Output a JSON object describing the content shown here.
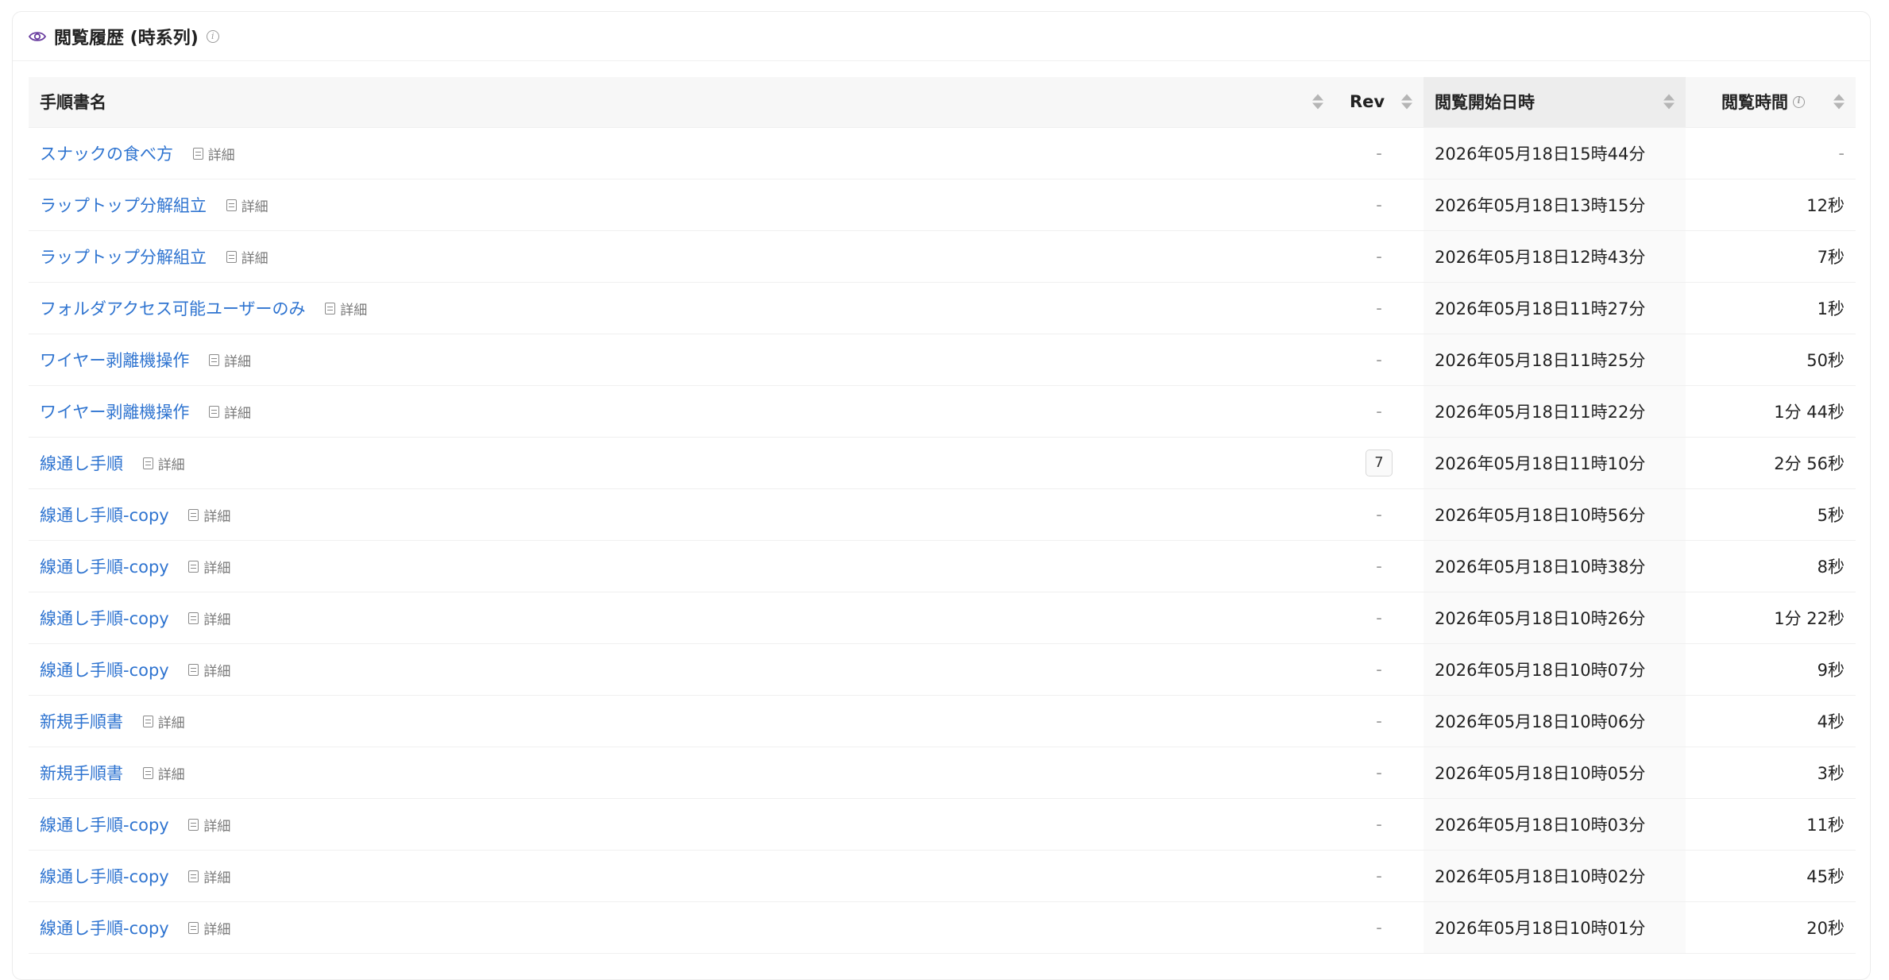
{
  "panel": {
    "title": "閲覧履歴 (時系列)"
  },
  "table": {
    "headers": {
      "name": "手順書名",
      "rev": "Rev",
      "start": "閲覧開始日時",
      "duration": "閲覧時間"
    },
    "detail_label": "詳細",
    "rows": [
      {
        "name": "スナックの食べ方",
        "rev": "-",
        "start": "2026年05月18日15時44分",
        "duration": "-"
      },
      {
        "name": "ラップトップ分解組立",
        "rev": "-",
        "start": "2026年05月18日13時15分",
        "duration": "12秒"
      },
      {
        "name": "ラップトップ分解組立",
        "rev": "-",
        "start": "2026年05月18日12時43分",
        "duration": "7秒"
      },
      {
        "name": "フォルダアクセス可能ユーザーのみ",
        "rev": "-",
        "start": "2026年05月18日11時27分",
        "duration": "1秒"
      },
      {
        "name": "ワイヤー剥離機操作",
        "rev": "-",
        "start": "2026年05月18日11時25分",
        "duration": "50秒"
      },
      {
        "name": "ワイヤー剥離機操作",
        "rev": "-",
        "start": "2026年05月18日11時22分",
        "duration": "1分 44秒"
      },
      {
        "name": "線通し手順",
        "rev": "7",
        "start": "2026年05月18日11時10分",
        "duration": "2分 56秒"
      },
      {
        "name": "線通し手順-copy",
        "rev": "-",
        "start": "2026年05月18日10時56分",
        "duration": "5秒"
      },
      {
        "name": "線通し手順-copy",
        "rev": "-",
        "start": "2026年05月18日10時38分",
        "duration": "8秒"
      },
      {
        "name": "線通し手順-copy",
        "rev": "-",
        "start": "2026年05月18日10時26分",
        "duration": "1分 22秒"
      },
      {
        "name": "線通し手順-copy",
        "rev": "-",
        "start": "2026年05月18日10時07分",
        "duration": "9秒"
      },
      {
        "name": "新規手順書",
        "rev": "-",
        "start": "2026年05月18日10時06分",
        "duration": "4秒"
      },
      {
        "name": "新規手順書",
        "rev": "-",
        "start": "2026年05月18日10時05分",
        "duration": "3秒"
      },
      {
        "name": "線通し手順-copy",
        "rev": "-",
        "start": "2026年05月18日10時03分",
        "duration": "11秒"
      },
      {
        "name": "線通し手順-copy",
        "rev": "-",
        "start": "2026年05月18日10時02分",
        "duration": "45秒"
      },
      {
        "name": "線通し手順-copy",
        "rev": "-",
        "start": "2026年05月18日10時01分",
        "duration": "20秒"
      }
    ]
  },
  "colors": {
    "link": "#2f74d0",
    "eye_icon": "#6b3fa0"
  }
}
